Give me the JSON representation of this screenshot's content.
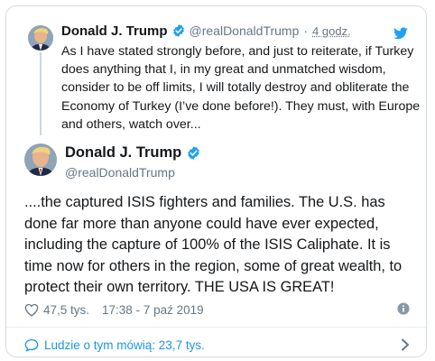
{
  "colors": {
    "accent": "#1da1f2",
    "link": "#1b95e0",
    "text": "#14171a",
    "muted": "#657786",
    "border": "#d6dde3"
  },
  "parent_tweet": {
    "name": "Donald J. Trump",
    "handle": "@realDonaldTrump",
    "separator": "·",
    "time": "4 godz.",
    "text": "As I have stated strongly before, and just to reiterate, if Turkey does anything that I, in my great and unmatched wisdom, consider to be off limits, I will totally destroy and obliterate the Economy of Turkey (I’ve done before!). They must, with Europe and others, watch over...",
    "icons": {
      "verified": "verified-badge-icon",
      "brand": "twitter-bird-icon"
    }
  },
  "main_tweet": {
    "name": "Donald J. Trump",
    "handle": "@realDonaldTrump",
    "text": "....the captured ISIS fighters and families. The U.S. has done far more than anyone could have ever expected, including the capture of 100% of the ISIS Caliphate. It is time now for others in the region, some of great wealth, to protect their own territory. THE USA IS GREAT!",
    "likes": "47,5 tys.",
    "timestamp": "17:38 - 7 paź 2019",
    "icons": {
      "like": "heart-icon",
      "info": "info-icon"
    }
  },
  "footer": {
    "talk_label": "Ludzie o tym mówią: 23,7 tys.",
    "icons": {
      "reply": "speech-bubble-icon",
      "more": "chevron-right-icon"
    }
  }
}
